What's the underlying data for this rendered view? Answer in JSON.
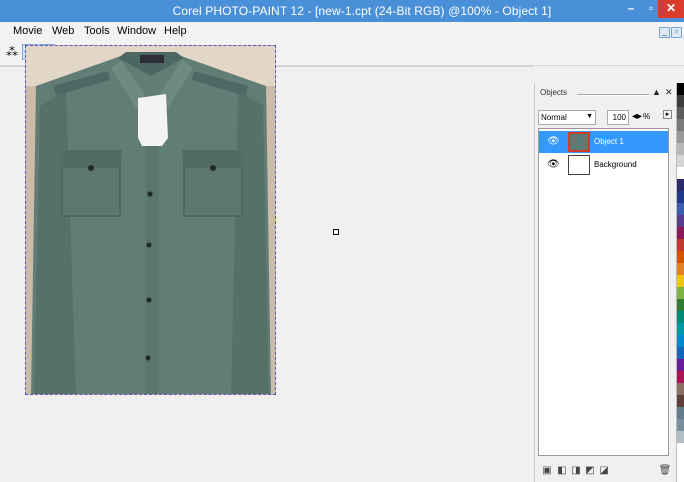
{
  "window": {
    "title": "Corel PHOTO-PAINT 12 - [new-1.cpt (24-Bit RGB) @100% - Object 1]",
    "minimize_glyph": "–",
    "maximize_glyph": "▫",
    "close_glyph": "✕"
  },
  "menu": {
    "items": [
      {
        "label": "Movie",
        "underline": "M"
      },
      {
        "label": "Web",
        "underline": "e"
      },
      {
        "label": "Tools",
        "underline": "T"
      },
      {
        "label": "Window",
        "underline": "W"
      },
      {
        "label": "Help",
        "underline": "H"
      }
    ],
    "mdi_min": "_",
    "mdi_restore": "▫"
  },
  "toolbar": {
    "items": [
      {
        "icon": "mask-icon",
        "glyph": "⁂"
      },
      {
        "icon": "show-mask-marquee-icon",
        "glyph": "▨",
        "active": true
      },
      {
        "icon": "show-object-marquee-icon",
        "glyph": "▩",
        "active": true
      },
      {
        "icon": "clip-mask-icon",
        "glyph": "◎"
      },
      {
        "icon": "lock-transparency-icon",
        "glyph": "▦"
      },
      {
        "icon": "text-icon",
        "glyph": "Ą·"
      }
    ]
  },
  "canvas": {
    "image_label": "shirt photo",
    "node_handle": "object node handle"
  },
  "objects_docker": {
    "title": "Objects",
    "collapse_glyph": "▲",
    "close_glyph": "✕",
    "merge_mode": "Normal",
    "opacity": "100",
    "opacity_unit": "%",
    "layers": [
      {
        "name": "Object 1",
        "selected": true,
        "visible": true
      },
      {
        "name": "Background",
        "selected": false,
        "visible": true
      }
    ],
    "footer_buttons": [
      "new-object-icon",
      "new-lens-icon",
      "combine-icon",
      "mask-from-object-icon",
      "clip-group-icon",
      "delete-object-icon"
    ]
  },
  "palette": {
    "colors": [
      "#000000",
      "#3d3d3d",
      "#5c5c5c",
      "#7a7a7a",
      "#999999",
      "#b8b8b8",
      "#d6d6d6",
      "#ffffff",
      "#2b2b6b",
      "#1e3a8a",
      "#3b5fb0",
      "#5a3d8f",
      "#8b1a5c",
      "#c0392b",
      "#d35400",
      "#e67e22",
      "#f1c40f",
      "#7cb342",
      "#2e7d32",
      "#00897b",
      "#0097a7",
      "#0288d1",
      "#1565c0",
      "#6a1b9a",
      "#ad1457",
      "#8d6e63",
      "#5d4037",
      "#607d8b",
      "#78909c",
      "#b0bec5",
      "#ffffff"
    ]
  }
}
